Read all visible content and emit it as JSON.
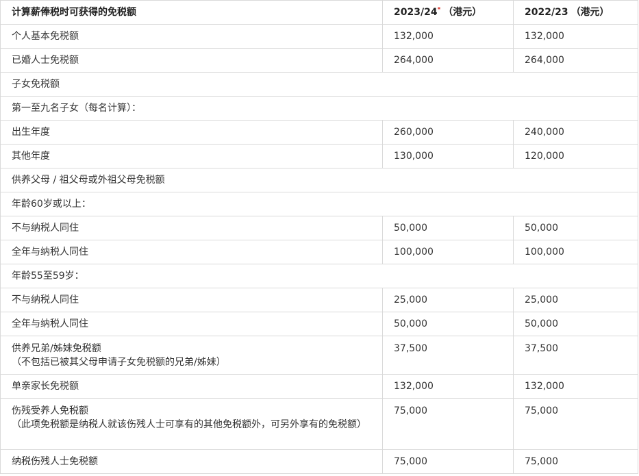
{
  "header": {
    "col1": "计算薪俸税时可获得的免税额",
    "col2_year": "2023/24",
    "col2_mark": "*",
    "col2_unit": "（港元）",
    "col3_year": "2022/23",
    "col3_unit": "（港元）"
  },
  "rows": [
    {
      "label": "个人基本免税额",
      "v1": "132,000",
      "v2": "132,000"
    },
    {
      "label": "已婚人士免税额",
      "v1": "264,000",
      "v2": "264,000"
    },
    {
      "label": "子女免税额"
    },
    {
      "label": "第一至九名子女（每名计算）："
    },
    {
      "label": "出生年度",
      "v1": "260,000",
      "v2": "240,000"
    },
    {
      "label": "其他年度",
      "v1": "130,000",
      "v2": "120,000"
    },
    {
      "label": "供养父母 / 祖父母或外祖父母免税额"
    },
    {
      "label": "年龄60岁或以上："
    },
    {
      "label": "不与纳税人同住",
      "v1": "50,000",
      "v2": "50,000"
    },
    {
      "label": "全年与纳税人同住",
      "v1": "100,000",
      "v2": "100,000"
    },
    {
      "label": "年龄55至59岁："
    },
    {
      "label": "不与纳税人同住",
      "v1": "25,000",
      "v2": "25,000"
    },
    {
      "label": "全年与纳税人同住",
      "v1": "50,000",
      "v2": "50,000"
    },
    {
      "label": "供养兄弟/姊妹免税额",
      "note": "（不包括已被其父母申请子女免税额的兄弟/姊妹）",
      "v1": "37,500",
      "v2": "37,500"
    },
    {
      "label": "单亲家长免税额",
      "v1": "132,000",
      "v2": "132,000"
    },
    {
      "label": "伤残受养人免税额",
      "note": "（此项免税额是纳税人就该伤残人士可享有的其他免税额外，可另外享有的免税额）",
      "v1": "75,000",
      "v2": "75,000"
    },
    {
      "label": "纳税伤残人士免税额",
      "v1": "75,000",
      "v2": "75,000"
    }
  ]
}
